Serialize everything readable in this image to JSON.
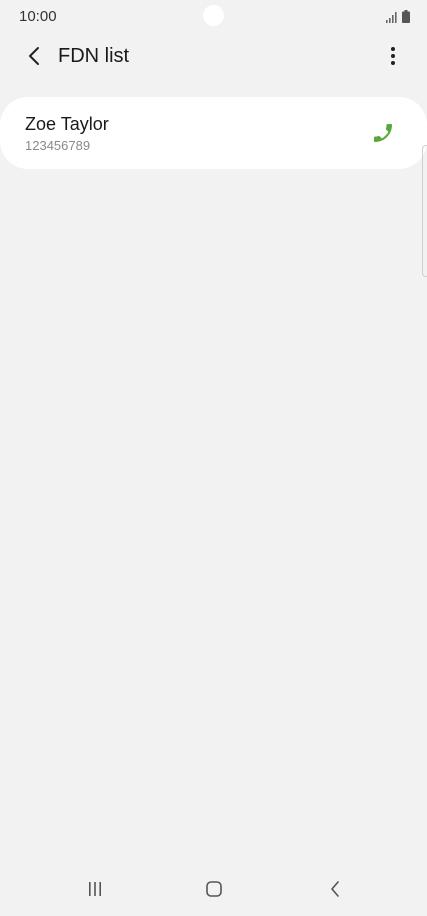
{
  "status_bar": {
    "time": "10:00",
    "icons": [
      "signal-icon",
      "battery-icon"
    ]
  },
  "app_bar": {
    "title": "FDN list",
    "back_icon": "back-arrow-icon",
    "more_icon": "more-vert-icon"
  },
  "contacts": [
    {
      "name": "Zoe Taylor",
      "number": "123456789",
      "action_icon": "phone-icon"
    }
  ],
  "nav_bar": {
    "icons": [
      "recents-icon",
      "home-icon",
      "back-icon"
    ]
  },
  "colors": {
    "background": "#f2f2f2",
    "card": "#ffffff",
    "call_green": "#5aa83c",
    "text_primary": "#1a1a1a",
    "text_secondary": "#8a8a8a"
  }
}
